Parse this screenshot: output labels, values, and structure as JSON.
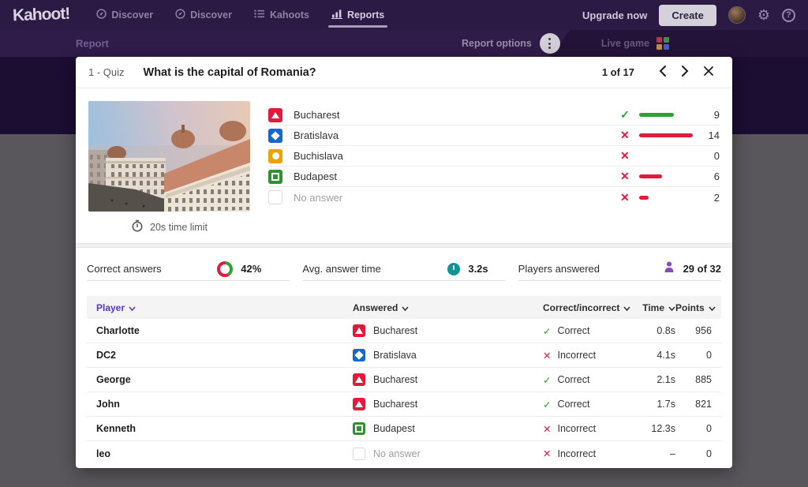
{
  "nav": {
    "logo": "Kahoot!",
    "items": [
      {
        "label": "Discover"
      },
      {
        "label": "Discover"
      },
      {
        "label": "Kahoots"
      },
      {
        "label": "Reports"
      }
    ],
    "upgrade_label": "Upgrade now",
    "create_label": "Create"
  },
  "subheader": {
    "title": "Report",
    "report_options": "Report options",
    "live_game": "Live game"
  },
  "modal": {
    "type_label": "1 - Quiz",
    "question": "What is the capital of Romania?",
    "pagination": "1 of 17",
    "time_limit": "20s time limit",
    "answers": [
      {
        "label": "Bucharest",
        "shape": "triangle",
        "color": "#e21b3c",
        "correct": true,
        "count": 9
      },
      {
        "label": "Bratislava",
        "shape": "diamond",
        "color": "#1368ce",
        "correct": false,
        "count": 14
      },
      {
        "label": "Buchislava",
        "shape": "circle",
        "color": "#eea200",
        "correct": false,
        "count": 0
      },
      {
        "label": "Budapest",
        "shape": "square",
        "color": "#2f9130",
        "correct": false,
        "count": 6
      },
      {
        "label": "No answer",
        "shape": "none",
        "color": "#ffffff",
        "correct": false,
        "count": 2
      }
    ],
    "stats": [
      {
        "label": "Correct answers",
        "value": "42%",
        "percent": 42
      },
      {
        "label": "Avg. answer time",
        "value": "3.2s"
      },
      {
        "label": "Players answered",
        "value": "29 of 32"
      }
    ],
    "table": {
      "columns": [
        "Player",
        "Answered",
        "Correct/incorrect",
        "Time",
        "Points"
      ],
      "rows": [
        {
          "player": "Charlotte",
          "answer": "Bucharest",
          "shape": "triangle",
          "color": "#e21b3c",
          "result": "Correct",
          "correct": true,
          "time": "0.8s",
          "points": "956"
        },
        {
          "player": "DC2",
          "answer": "Bratislava",
          "shape": "diamond",
          "color": "#1368ce",
          "result": "Incorrect",
          "correct": false,
          "time": "4.1s",
          "points": "0"
        },
        {
          "player": "George",
          "answer": "Bucharest",
          "shape": "triangle",
          "color": "#e21b3c",
          "result": "Correct",
          "correct": true,
          "time": "2.1s",
          "points": "885"
        },
        {
          "player": "John",
          "answer": "Bucharest",
          "shape": "triangle",
          "color": "#e21b3c",
          "result": "Correct",
          "correct": true,
          "time": "1.7s",
          "points": "821"
        },
        {
          "player": "Kenneth",
          "answer": "Budapest",
          "shape": "square",
          "color": "#2f9130",
          "result": "Incorrect",
          "correct": false,
          "time": "12.3s",
          "points": "0"
        },
        {
          "player": "leo",
          "answer": "No answer",
          "shape": "none",
          "color": "#ffffff",
          "result": "Incorrect",
          "correct": false,
          "time": "–",
          "points": "0"
        }
      ]
    }
  },
  "colors": {
    "green": "#2ba32c",
    "red": "#e21b3c",
    "accent": "#5436c9"
  }
}
